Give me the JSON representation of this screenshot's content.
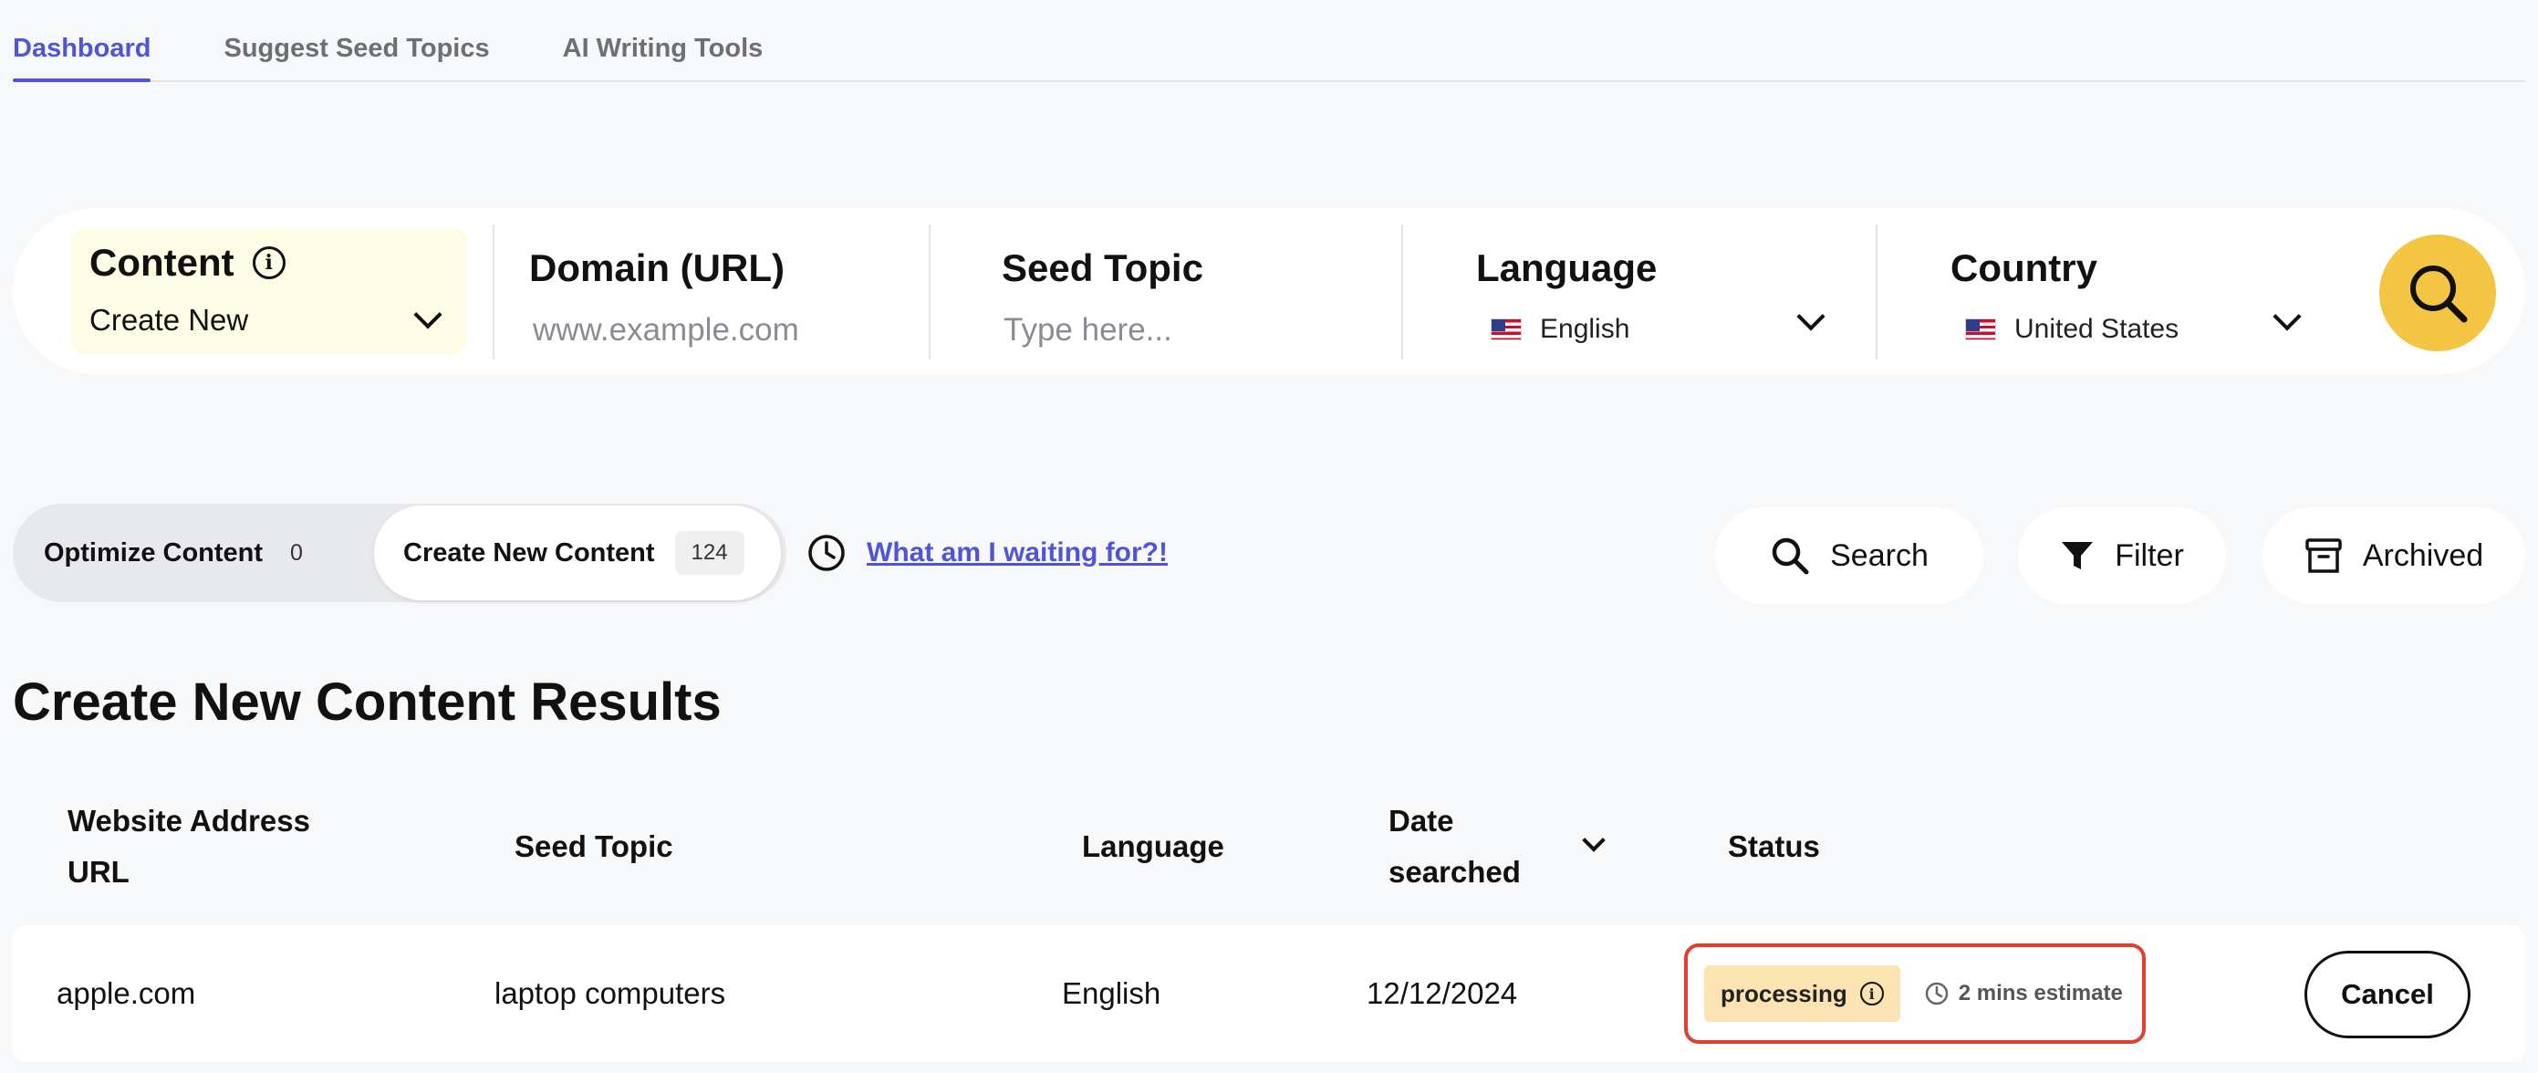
{
  "tabs": [
    {
      "label": "Dashboard",
      "active": true
    },
    {
      "label": "Suggest Seed Topics",
      "active": false
    },
    {
      "label": "AI Writing Tools",
      "active": false
    }
  ],
  "search_bar": {
    "content": {
      "label": "Content",
      "value": "Create New"
    },
    "domain": {
      "label": "Domain (URL)",
      "placeholder": "www.example.com"
    },
    "seed_topic": {
      "label": "Seed Topic",
      "placeholder": "Type here..."
    },
    "language": {
      "label": "Language",
      "value": "English"
    },
    "country": {
      "label": "Country",
      "value": "United States"
    },
    "submit_icon": "search-icon"
  },
  "segments": {
    "optimize": {
      "label": "Optimize Content",
      "count": "0"
    },
    "create": {
      "label": "Create New Content",
      "count": "124",
      "active": true
    }
  },
  "waiting_link": "What am I waiting for?!",
  "tools": {
    "search_label": "Search",
    "filter_label": "Filter",
    "archived_label": "Archived"
  },
  "results": {
    "title": "Create New Content Results",
    "columns": {
      "url": "Website Address URL",
      "seed": "Seed Topic",
      "language": "Language",
      "date": "Date searched",
      "status": "Status"
    },
    "rows": [
      {
        "url": "apple.com",
        "seed": "laptop computers",
        "language": "English",
        "date": "12/12/2024",
        "status": "processing",
        "estimate": "2 mins estimate",
        "action": "Cancel"
      }
    ]
  },
  "colors": {
    "accent": "#4f55d6",
    "search_button": "#f4c542",
    "status_badge": "#fbe3b2",
    "highlight_border": "#e0402f"
  }
}
